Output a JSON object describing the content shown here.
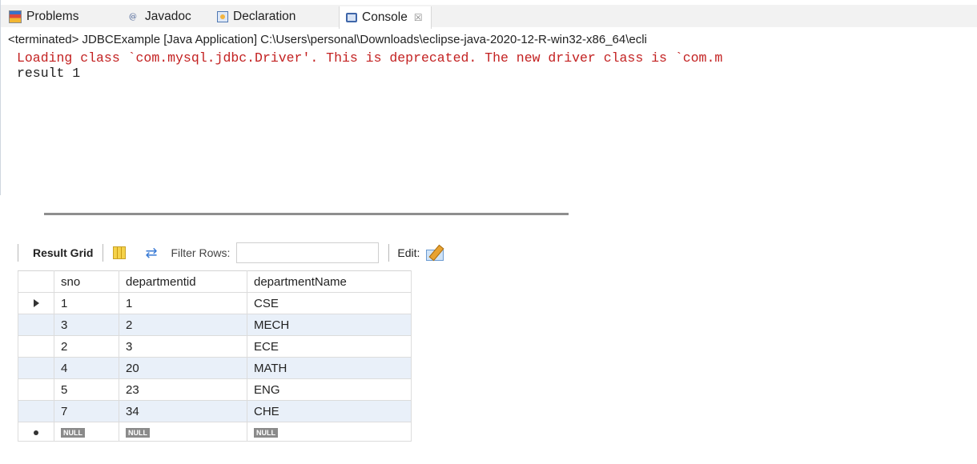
{
  "eclipse": {
    "tabs": [
      {
        "label": "Problems",
        "icon": "problems-icon"
      },
      {
        "label": "Javadoc",
        "icon": "javadoc-icon"
      },
      {
        "label": "Declaration",
        "icon": "declaration-icon"
      },
      {
        "label": "Console",
        "icon": "console-icon",
        "close": "☒"
      }
    ],
    "status": "<terminated> JDBCExample [Java Application] C:\\Users\\personal\\Downloads\\eclipse-java-2020-12-R-win32-x86_64\\ecli",
    "output_lines": [
      "Loading class `com.mysql.jdbc.Driver'. This is deprecated. The new driver class is `com.m",
      "result 1"
    ],
    "colors": {
      "error_text": "#c32121",
      "normal_text": "#202020"
    }
  },
  "workbench": {
    "toolbar": {
      "result_grid_label": "Result Grid",
      "filter_label": "Filter Rows:",
      "filter_value": "",
      "edit_label": "Edit:"
    },
    "grid": {
      "columns": [
        "sno",
        "departmentid",
        "departmentName"
      ],
      "rows": [
        [
          "1",
          "1",
          "CSE"
        ],
        [
          "3",
          "2",
          "MECH"
        ],
        [
          "2",
          "3",
          "ECE"
        ],
        [
          "4",
          "20",
          "MATH"
        ],
        [
          "5",
          "23",
          "ENG"
        ],
        [
          "7",
          "34",
          "CHE"
        ]
      ],
      "new_row": [
        "NULL",
        "NULL",
        "NULL"
      ],
      "colors": {
        "alt_row": "#e9f0f9"
      }
    }
  }
}
